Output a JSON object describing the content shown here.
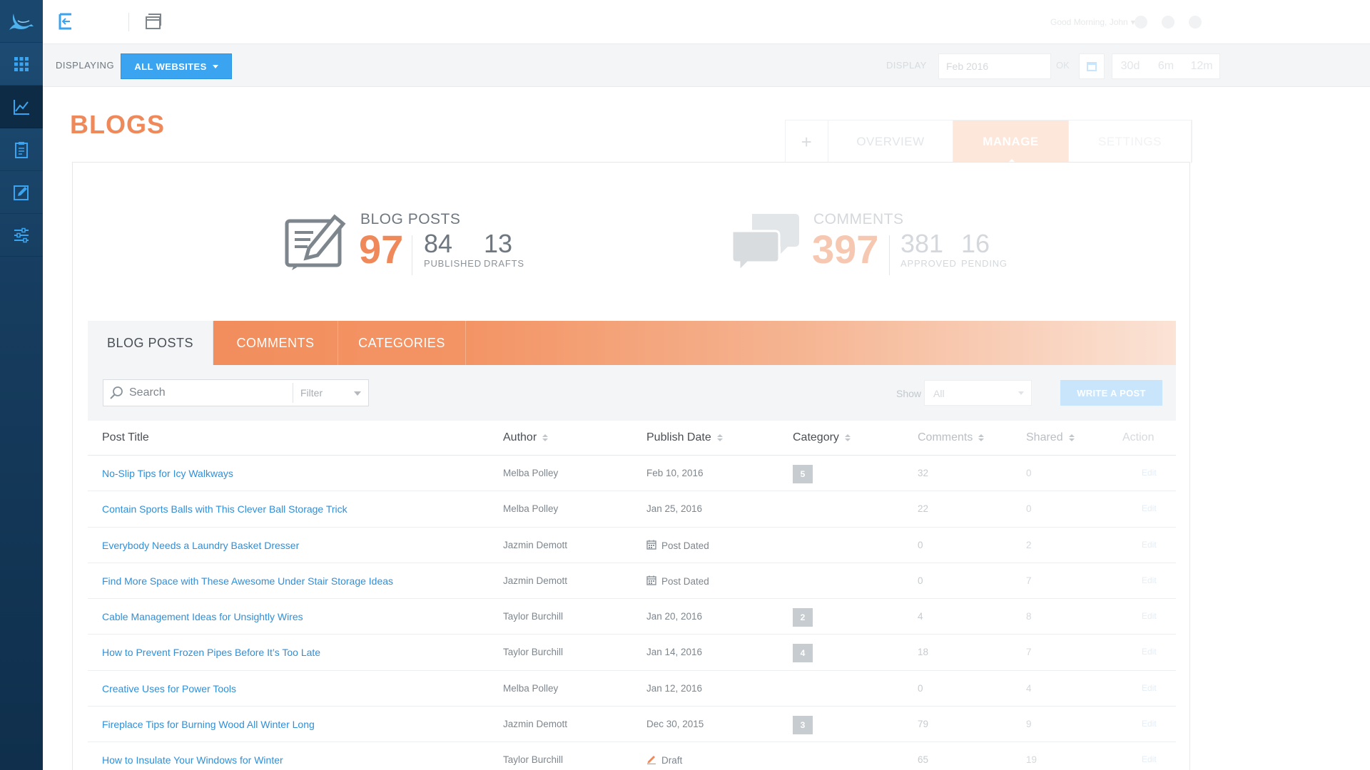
{
  "topbar": {
    "greeting": "Good Morning, John",
    "greeting_caret": "▾"
  },
  "filterbar": {
    "displaying_label": "DISPLAYING",
    "websites_button": "ALL WEBSITES",
    "display_label": "DISPLAY",
    "date_value": "Feb 2016",
    "ok_label": "OK",
    "ranges": [
      "30d",
      "6m",
      "12m"
    ]
  },
  "page": {
    "title": "BLOGS",
    "view_tabs": {
      "plus": "+",
      "overview": "OVERVIEW",
      "manage": "MANAGE",
      "settings": "SETTINGS"
    }
  },
  "stats": {
    "blog_posts": {
      "label": "BLOG POSTS",
      "total": "97",
      "published": "84",
      "published_label": "PUBLISHED",
      "drafts": "13",
      "drafts_label": "DRAFTS"
    },
    "comments": {
      "label": "COMMENTS",
      "total": "397",
      "approved": "381",
      "approved_label": "APPROVED",
      "pending": "16",
      "pending_label": "PENDING"
    }
  },
  "content_tabs": [
    "BLOG POSTS",
    "COMMENTS",
    "CATEGORIES"
  ],
  "toolbar": {
    "search_placeholder": "Search",
    "filter_label": "Filter",
    "show_label": "Show",
    "show_value": "All",
    "write_button": "WRITE A POST"
  },
  "table": {
    "headers": {
      "title": "Post Title",
      "author": "Author",
      "date": "Publish Date",
      "category": "Category",
      "comments": "Comments",
      "shared": "Shared",
      "action": "Action"
    },
    "rows": [
      {
        "title": "No-Slip Tips for Icy Walkways",
        "author": "Melba Polley",
        "date": "Feb 10, 2016",
        "date_icon": "",
        "category": "5",
        "comments": "32",
        "shared": "0",
        "action": "Edit"
      },
      {
        "title": "Contain Sports Balls with This Clever Ball Storage Trick",
        "author": "Melba Polley",
        "date": "Jan 25, 2016",
        "date_icon": "",
        "category": "",
        "comments": "22",
        "shared": "0",
        "action": "Edit"
      },
      {
        "title": "Everybody Needs a Laundry Basket Dresser",
        "author": "Jazmin Demott",
        "date": "Post Dated",
        "date_icon": "calendar-icon",
        "category": "",
        "comments": "0",
        "shared": "2",
        "action": "Edit"
      },
      {
        "title": "Find More Space with These Awesome Under Stair Storage Ideas",
        "author": "Jazmin Demott",
        "date": "Post Dated",
        "date_icon": "calendar-icon",
        "category": "",
        "comments": "0",
        "shared": "7",
        "action": "Edit"
      },
      {
        "title": "Cable Management Ideas for Unsightly Wires",
        "author": "Taylor Burchill",
        "date": "Jan 20, 2016",
        "date_icon": "",
        "category": "2",
        "comments": "4",
        "shared": "8",
        "action": "Edit"
      },
      {
        "title": "How to Prevent Frozen Pipes Before It’s Too Late",
        "author": "Taylor Burchill",
        "date": "Jan 14, 2016",
        "date_icon": "",
        "category": "4",
        "comments": "18",
        "shared": "7",
        "action": "Edit"
      },
      {
        "title": "Creative Uses for Power Tools",
        "author": "Melba Polley",
        "date": "Jan 12, 2016",
        "date_icon": "",
        "category": "",
        "comments": "0",
        "shared": "4",
        "action": "Edit"
      },
      {
        "title": "Fireplace Tips for Burning Wood All Winter Long",
        "author": "Jazmin Demott",
        "date": "Dec 30, 2015",
        "date_icon": "",
        "category": "3",
        "comments": "79",
        "shared": "9",
        "action": "Edit"
      },
      {
        "title": "How to Insulate Your Windows for Winter",
        "author": "Taylor Burchill",
        "date": "Draft",
        "date_icon": "pencil-icon",
        "category": "",
        "comments": "65",
        "shared": "19",
        "action": "Edit"
      }
    ]
  },
  "colors": {
    "accent_orange": "#f0895a",
    "primary_blue": "#3aa4f0",
    "link_blue": "#2f8fd8",
    "sidebar": "#163c5e"
  }
}
